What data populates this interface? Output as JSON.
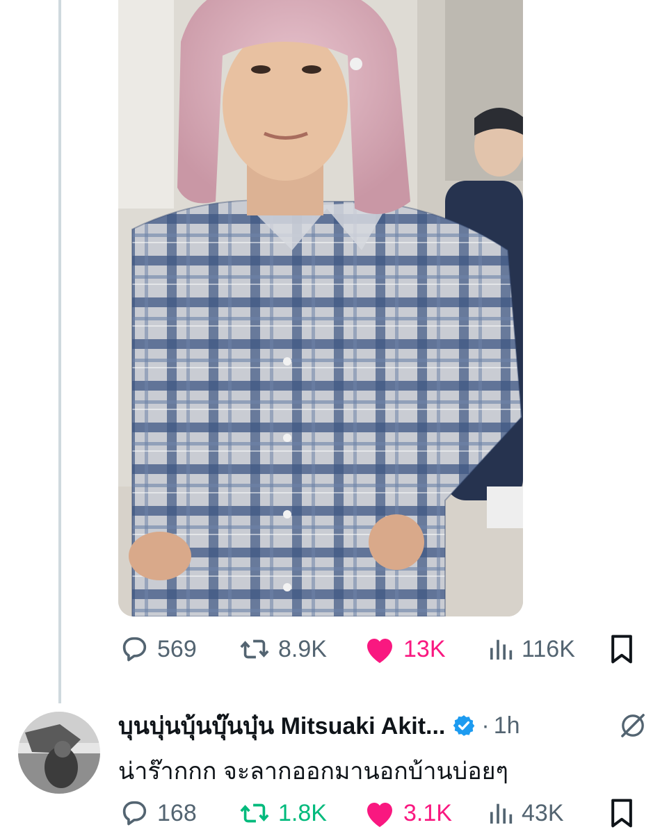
{
  "post": {
    "media": {
      "description_icon": "photo"
    },
    "stats": {
      "replies": "569",
      "reposts": "8.9K",
      "likes": "13K",
      "views": "116K"
    }
  },
  "reply": {
    "display_name": "บุนบุ่นบุ้นบุ๊นบุ๋น Mitsuaki Akit...",
    "verified": true,
    "separator": "·",
    "time": "1h",
    "text": "น่าร๊ากกก จะลากออกมานอกบ้านบ่อยๆ",
    "stats": {
      "replies": "168",
      "reposts": "1.8K",
      "likes": "3.1K",
      "views": "43K"
    }
  },
  "colors": {
    "like": "#f91880",
    "repost_active": "#00ba7c",
    "muted": "#536471",
    "verified": "#1d9bf0",
    "thread_line": "#cfd9de"
  },
  "icons": [
    "reply-icon",
    "repost-icon",
    "heart-icon",
    "views-icon",
    "bookmark-icon",
    "verified-badge-icon",
    "grok-icon"
  ]
}
